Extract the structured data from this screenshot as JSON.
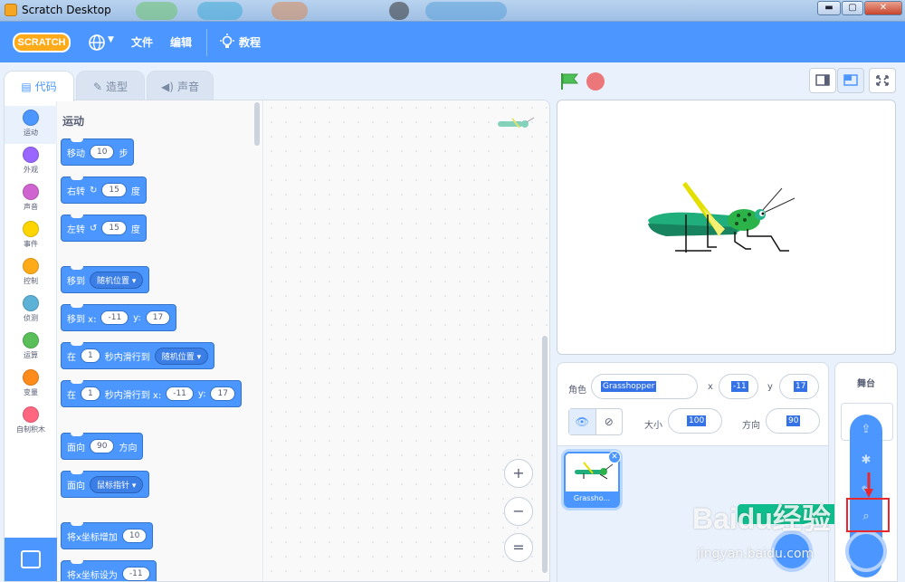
{
  "window": {
    "title": "Scratch Desktop",
    "minimize": "▬",
    "maximize": "▢",
    "close": "✕"
  },
  "menubar": {
    "logo": "SCRATCH",
    "language_icon": "globe-icon",
    "file": "文件",
    "edit": "编辑",
    "tutorials": "教程"
  },
  "tabs": [
    {
      "label": "代码",
      "icon": "code-icon"
    },
    {
      "label": "造型",
      "icon": "brush-icon"
    },
    {
      "label": "声音",
      "icon": "speaker-icon"
    }
  ],
  "categories": [
    {
      "label": "运动",
      "color": "#4c97ff"
    },
    {
      "label": "外观",
      "color": "#9966ff"
    },
    {
      "label": "声音",
      "color": "#cf63cf"
    },
    {
      "label": "事件",
      "color": "#ffd500"
    },
    {
      "label": "控制",
      "color": "#ffab19"
    },
    {
      "label": "侦测",
      "color": "#5cb1d6"
    },
    {
      "label": "运算",
      "color": "#59c059"
    },
    {
      "label": "变量",
      "color": "#ff8c1a"
    },
    {
      "label": "自制积木",
      "color": "#ff6680"
    }
  ],
  "palette": {
    "title": "运动",
    "blocks": {
      "move": {
        "t1": "移动",
        "v1": "10",
        "t2": "步"
      },
      "turn_right": {
        "t1": "右转",
        "v1": "15",
        "t2": "度"
      },
      "turn_left": {
        "t1": "左转",
        "v1": "15",
        "t2": "度"
      },
      "goto": {
        "t1": "移到",
        "d1": "随机位置 ▾"
      },
      "goto_xy": {
        "t1": "移到 x:",
        "v1": "-11",
        "t2": "y:",
        "v2": "17"
      },
      "glide": {
        "t1": "在",
        "v1": "1",
        "t2": "秒内滑行到",
        "d1": "随机位置 ▾"
      },
      "glide_xy": {
        "t1": "在",
        "v1": "1",
        "t2": "秒内滑行到 x:",
        "v2": "-11",
        "t3": "y:",
        "v3": "17"
      },
      "point_dir": {
        "t1": "面向",
        "v1": "90",
        "t2": "方向"
      },
      "point_towards": {
        "t1": "面向",
        "d1": "鼠标指针 ▾"
      },
      "change_x": {
        "t1": "将x坐标增加",
        "v1": "10"
      },
      "set_x": {
        "t1": "将x坐标设为",
        "v1": "-11"
      }
    }
  },
  "zoom": {
    "in": "+",
    "out": "−",
    "reset": "="
  },
  "sprite_info": {
    "sprite_label": "角色",
    "sprite_name": "Grasshopper",
    "x_label": "x",
    "x_value": "-11",
    "y_label": "y",
    "y_value": "17",
    "size_label": "大小",
    "size_value": "100",
    "direction_label": "方向",
    "direction_value": "90",
    "show_icon": "eye-icon",
    "hide_icon": "eye-slash-icon"
  },
  "sprite_list": [
    {
      "name": "Grassho..."
    }
  ],
  "stage_panel": {
    "title": "舞台"
  },
  "watermark": {
    "main": "Baidu经验",
    "sub": "jingyan.baidu.com"
  }
}
